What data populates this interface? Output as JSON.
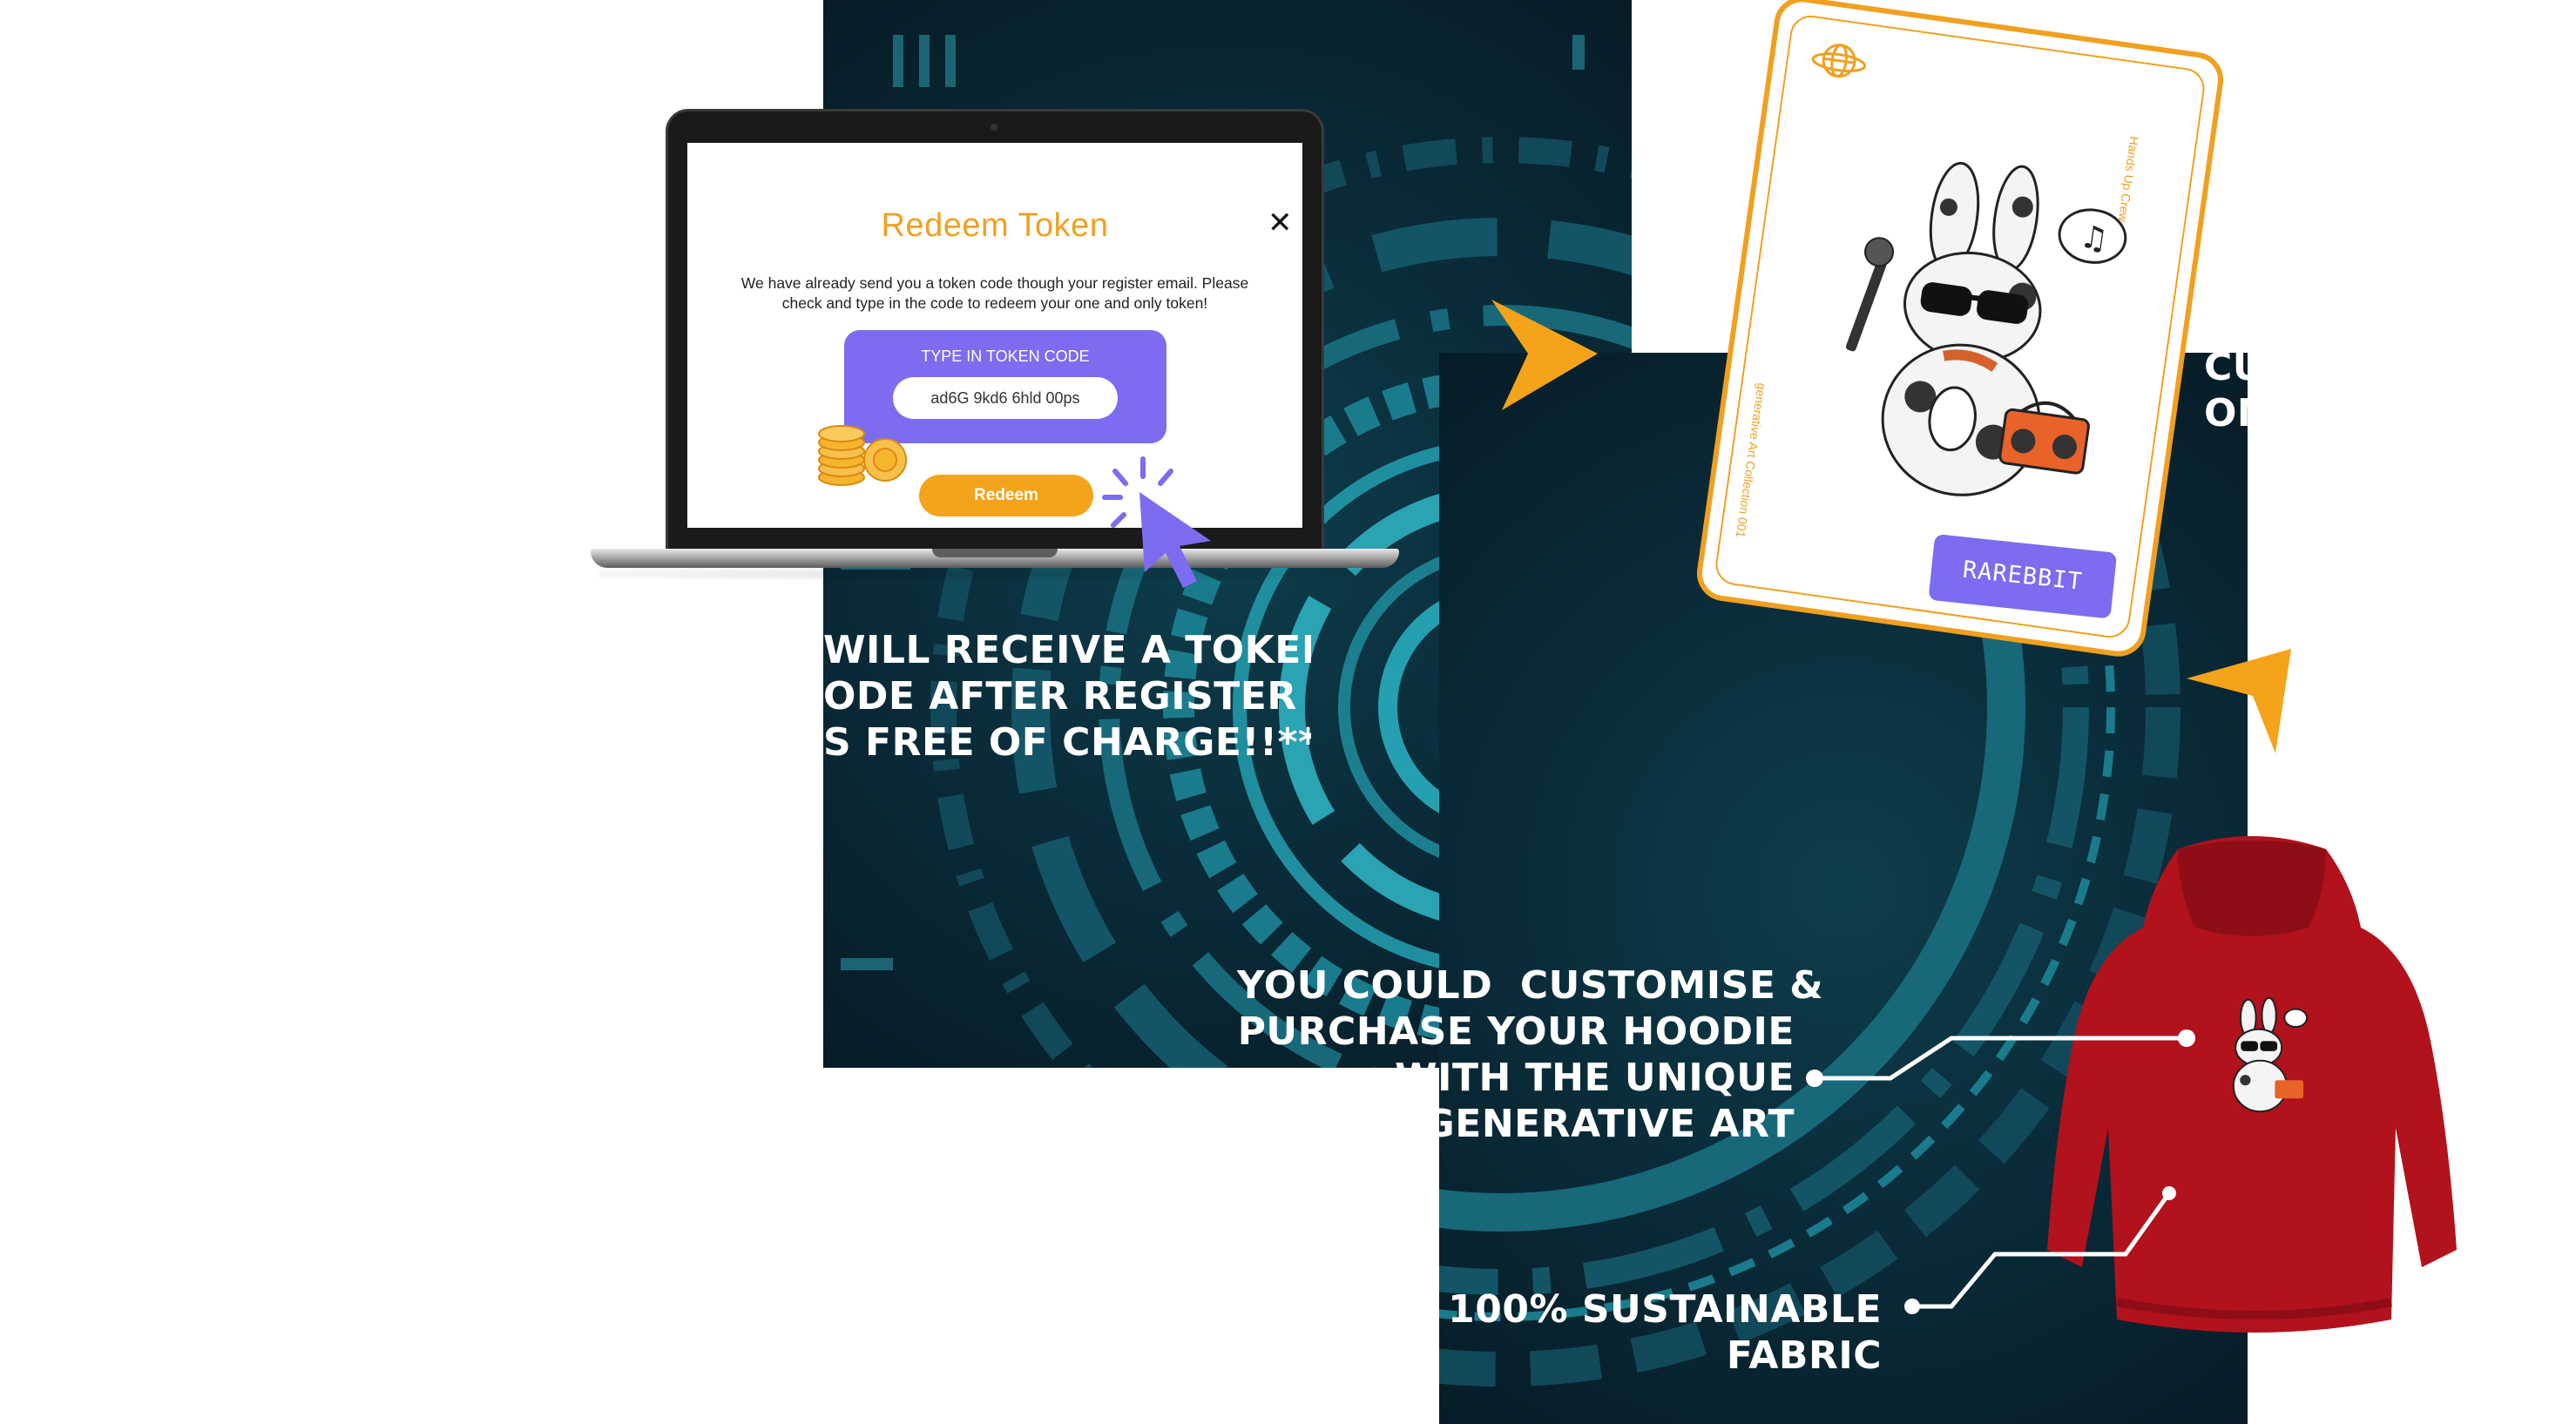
{
  "modal": {
    "title": "Redeem Token",
    "close_glyph": "✕",
    "description": "We have already send you a token code though your register email. Please check and type in the code to redeem your one and only token!",
    "token_label": "TYPE IN TOKEN CODE",
    "token_value": "ad6G 9kd6 6hld 00ps",
    "redeem_label": "Redeem"
  },
  "card": {
    "side_text_right": "Hands Up Crew",
    "side_text_left": "generative Art Collection 001",
    "button_label": "RAREBBIT",
    "music_note": "♫",
    "icons": [
      "globe-icon",
      "music-note-icon",
      "microphone-icon",
      "boombox-icon"
    ]
  },
  "headlines": {
    "token_lines": [
      "WILL RECEIVE A TOKEN",
      "ODE AFTER REGISTER",
      "S FREE OF CHARGE!!**"
    ],
    "hoodie_lines": [
      "YOU COULD  CUSTOMISE &",
      "PURCHASE YOUR HOODIE",
      "WITH THE UNIQUE",
      "GENERATIVE ART"
    ],
    "fabric_lines": [
      "100% SUSTAINABLE",
      "FABRIC"
    ],
    "edge_lines": [
      "CU",
      "ON"
    ]
  },
  "colors": {
    "accent_orange": "#f0a020",
    "accent_purple": "#7b6cf0",
    "background_teal": "#0a2d3b",
    "hoodie_red": "#b2121c"
  }
}
